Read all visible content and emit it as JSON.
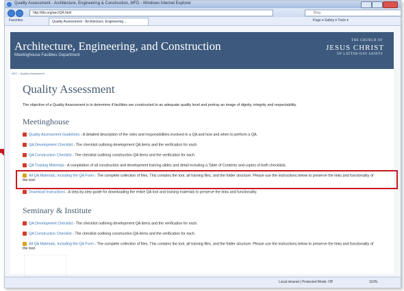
{
  "window": {
    "title": "Quality Assessment - Architecture, Engineering & Construction, MFD - Windows Internet Explorer"
  },
  "browser": {
    "url": "http://lds.org/aec/QA.html",
    "search_placeholder": "Bing",
    "favorites_label": "Favorites",
    "tab_title": "Quality Assessment - Architecture, Engineering ...",
    "tools_text": "Page ▾  Safety ▾  Tools ▾",
    "status_zone": "Local intranet | Protected Mode: Off",
    "zoom": "110%"
  },
  "header": {
    "title": "Architecture, Engineering, and Construction",
    "subtitle": "Meetinghouse Facilities Department",
    "logo_line1": "THE CHURCH OF",
    "logo_line2": "JESUS CHRIST",
    "logo_line3": "OF LATTER-DAY SAINTS"
  },
  "page": {
    "breadcrumb": "AEC > Quality Assessment",
    "title": "Quality Assessment",
    "intro": "The objective of a Quality Assessment is to determine if facilities are constructed to an adequate quality level and portray an image of dignity, integrity and respectability.",
    "sections": [
      {
        "heading": "Meetinghouse",
        "items": [
          {
            "link": "Quality Assessment Guidelines",
            "desc": " - A detailed description of the roles and responsibilities involved in a QA and how and when to perform a QA.",
            "icon": "pdf-icon"
          },
          {
            "link": "QA Development Checklist",
            "desc": " - The checklist outlining development QA items and the verification for each.",
            "icon": "pdf-icon"
          },
          {
            "link": "QA Construction Checklist",
            "desc": " - The checklist outlining construction QA items and the verification for each.",
            "icon": "pdf-icon"
          },
          {
            "link": "QA Training Materials",
            "desc": " - A compilation of all construction and development training slides and detail including a Table of Contents and copies of both checklists.",
            "icon": "pdf-icon"
          },
          {
            "link": "All QA Materials, Including the QA Form",
            "desc": " - The complete collection of files. This contains the tool, all training files, and the folder structure. Please use the instructions below to preserve the links and functionality of the tool.",
            "icon": "zip-icon"
          },
          {
            "link": "Download Instructions",
            "desc": " - A step-by-step guide for downloading the entire QA tool and training materials to preserve the links and functionality.",
            "icon": "pdf-icon"
          }
        ]
      },
      {
        "heading": "Seminary & Institute",
        "items": [
          {
            "link": "QA Development Checklist",
            "desc": " - The checklist outlining development QA items and the verification for each.",
            "icon": "pdf-icon"
          },
          {
            "link": "QA Construction Checklist",
            "desc": " - The checklist outlining construction QA items and the verification for each.",
            "icon": "pdf-icon"
          },
          {
            "link": "All QA Materials, Including the QA Form",
            "desc": " - The complete collection of files. This contains the tool, all training files, and the folder structure. Please use the instructions below to preserve the links and functionality of the tool.",
            "icon": "zip-icon"
          }
        ]
      }
    ]
  },
  "colors": {
    "header_bg": "#3d5a7e",
    "link": "#2e6db5",
    "highlight": "#c9171d"
  }
}
